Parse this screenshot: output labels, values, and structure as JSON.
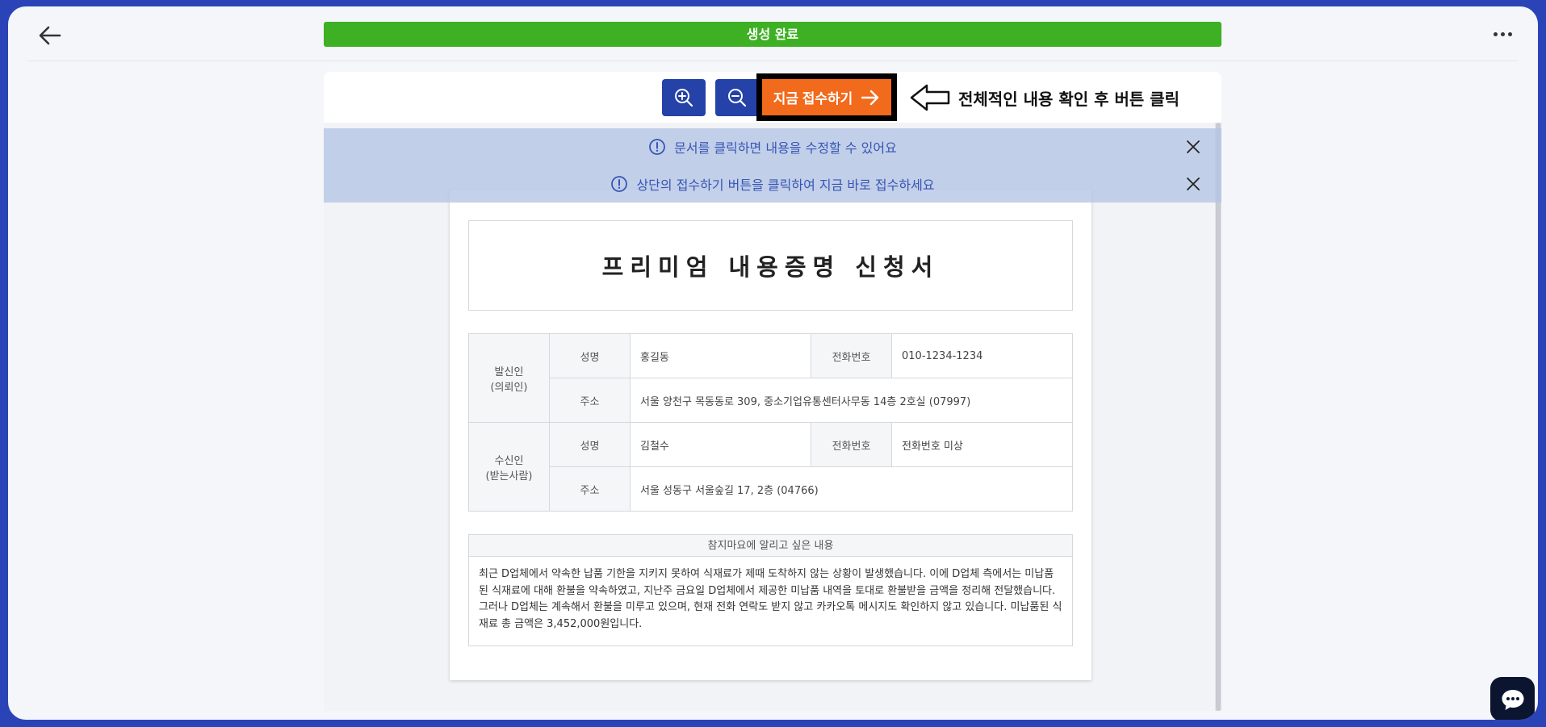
{
  "header": {
    "status_text": "생성 완료"
  },
  "toolbar": {
    "submit_label": "지금 접수하기",
    "hint_text": "전체적인 내용 확인 후 버튼 클릭"
  },
  "notices": [
    {
      "text": "문서를 클릭하면 내용을 수정할 수 있어요"
    },
    {
      "text": "상단의 접수하기 버튼을 클릭하여 지금 바로 접수하세요"
    }
  ],
  "document": {
    "title": "프리미엄 내용증명 신청서",
    "sender": {
      "role_line1": "발신인",
      "role_line2": "(의뢰인)",
      "name_label": "성명",
      "name": "홍길동",
      "phone_label": "전화번호",
      "phone": "010-1234-1234",
      "address_label": "주소",
      "address": "서울 양천구 목동동로 309, 중소기업유통센터사무동 14층 2호실 (07997)"
    },
    "recipient": {
      "role_line1": "수신인",
      "role_line2": "(받는사람)",
      "name_label": "성명",
      "name": "김철수",
      "phone_label": "전화번호",
      "phone": "전화번호 미상",
      "address_label": "주소",
      "address": "서울 성동구 서울숲길 17, 2층 (04766)"
    },
    "memo": {
      "heading": "참지마요에 알리고 싶은 내용",
      "body": "최근 D업체에서 약속한 납품 기한을 지키지 못하여 식재료가 제때 도착하지 않는 상황이 발생했습니다. 이에 D업체 측에서는 미납품된 식재료에 대해 환불을 약속하였고, 지난주 금요일 D업체에서 제공한 미납품 내역을 토대로 환불받을 금액을 정리해 전달했습니다. 그러나 D업체는 계속해서 환불을 미루고 있으며, 현재 전화 연락도 받지 않고 카카오톡 메시지도 확인하지 않고 있습니다. 미납품된 식재료 총 금액은 3,452,000원입니다."
    }
  },
  "colors": {
    "status_green": "#3db023",
    "submit_orange": "#f26a1b",
    "zoom_blue": "#2442a8",
    "frame_blue": "#2a44b8"
  },
  "icons": {
    "back": "arrow-left-icon",
    "more": "more-dots-icon",
    "zoom_in": "zoom-in-icon",
    "zoom_out": "zoom-out-icon",
    "arrow_right": "arrow-right-icon",
    "info": "info-circle-icon",
    "close": "close-icon",
    "chat": "chat-bubble-icon"
  }
}
